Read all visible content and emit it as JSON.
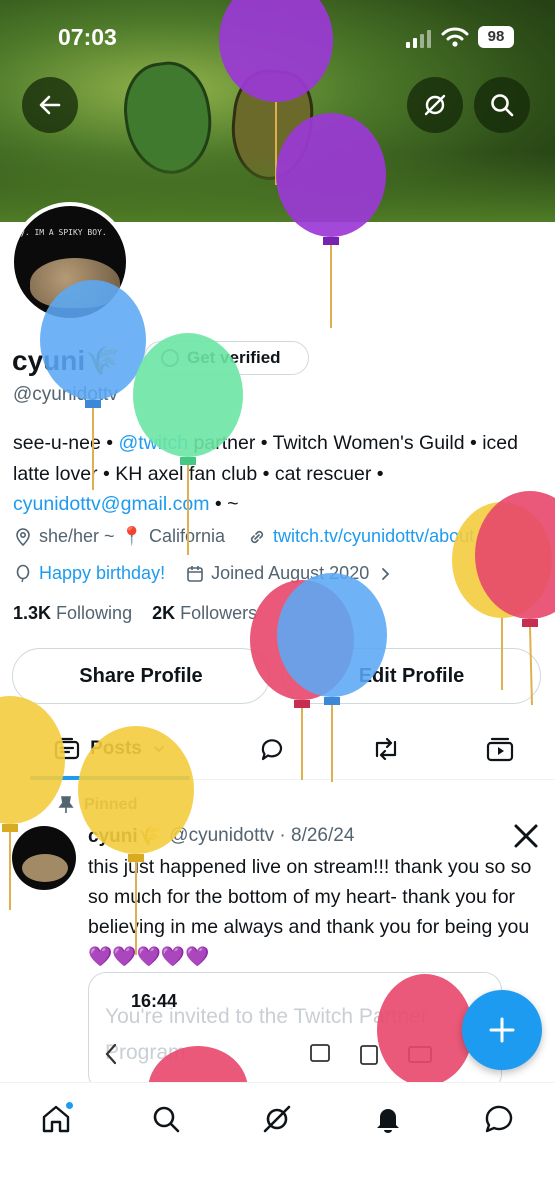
{
  "status_bar": {
    "time": "07:03",
    "battery": "98"
  },
  "header": {
    "back": "back",
    "grok": "grok",
    "search": "search"
  },
  "profile": {
    "display_name": "cyuni🌾",
    "verify_label": "Get verified",
    "handle": "@cyunidottv",
    "bio_1": "see-u-nee • ",
    "bio_mention": "@twitch",
    "bio_2": " partner • Twitch Women's Guild • iced latte lover • KH axel fan club • cat rescuer • ",
    "bio_email": "cyunidottv@gmail.com",
    "bio_3": " • ~",
    "pronouns": "she/her ~",
    "location": "California",
    "website": "twitch.tv/cyunidottv/about",
    "birthday": "Happy birthday!",
    "joined": "Joined August 2020",
    "following_count": "1.3K",
    "following_label": "Following",
    "followers_count": "2K",
    "followers_label": "Followers",
    "avatar_caption": "y. IM A SPIKY BOY."
  },
  "actions": {
    "share": "Share Profile",
    "edit": "Edit Profile"
  },
  "tabs": {
    "posts": "Posts"
  },
  "post": {
    "pinned_label": "Pinned",
    "name": "cyuni🌾",
    "handle_date": "@cyunidottv · 8/26/24",
    "text": "this just happened live on stream!!! thank you so so so much for the bottom of my heart- thank you for believing in me always and thank you for being you 💜💜💜💜💜",
    "embed_time": "16:44",
    "embed_title": "You're invited to the Twitch Partner Program"
  },
  "colors": {
    "accent": "#1d9bf0",
    "text": "#0f1419",
    "muted": "#536471"
  }
}
